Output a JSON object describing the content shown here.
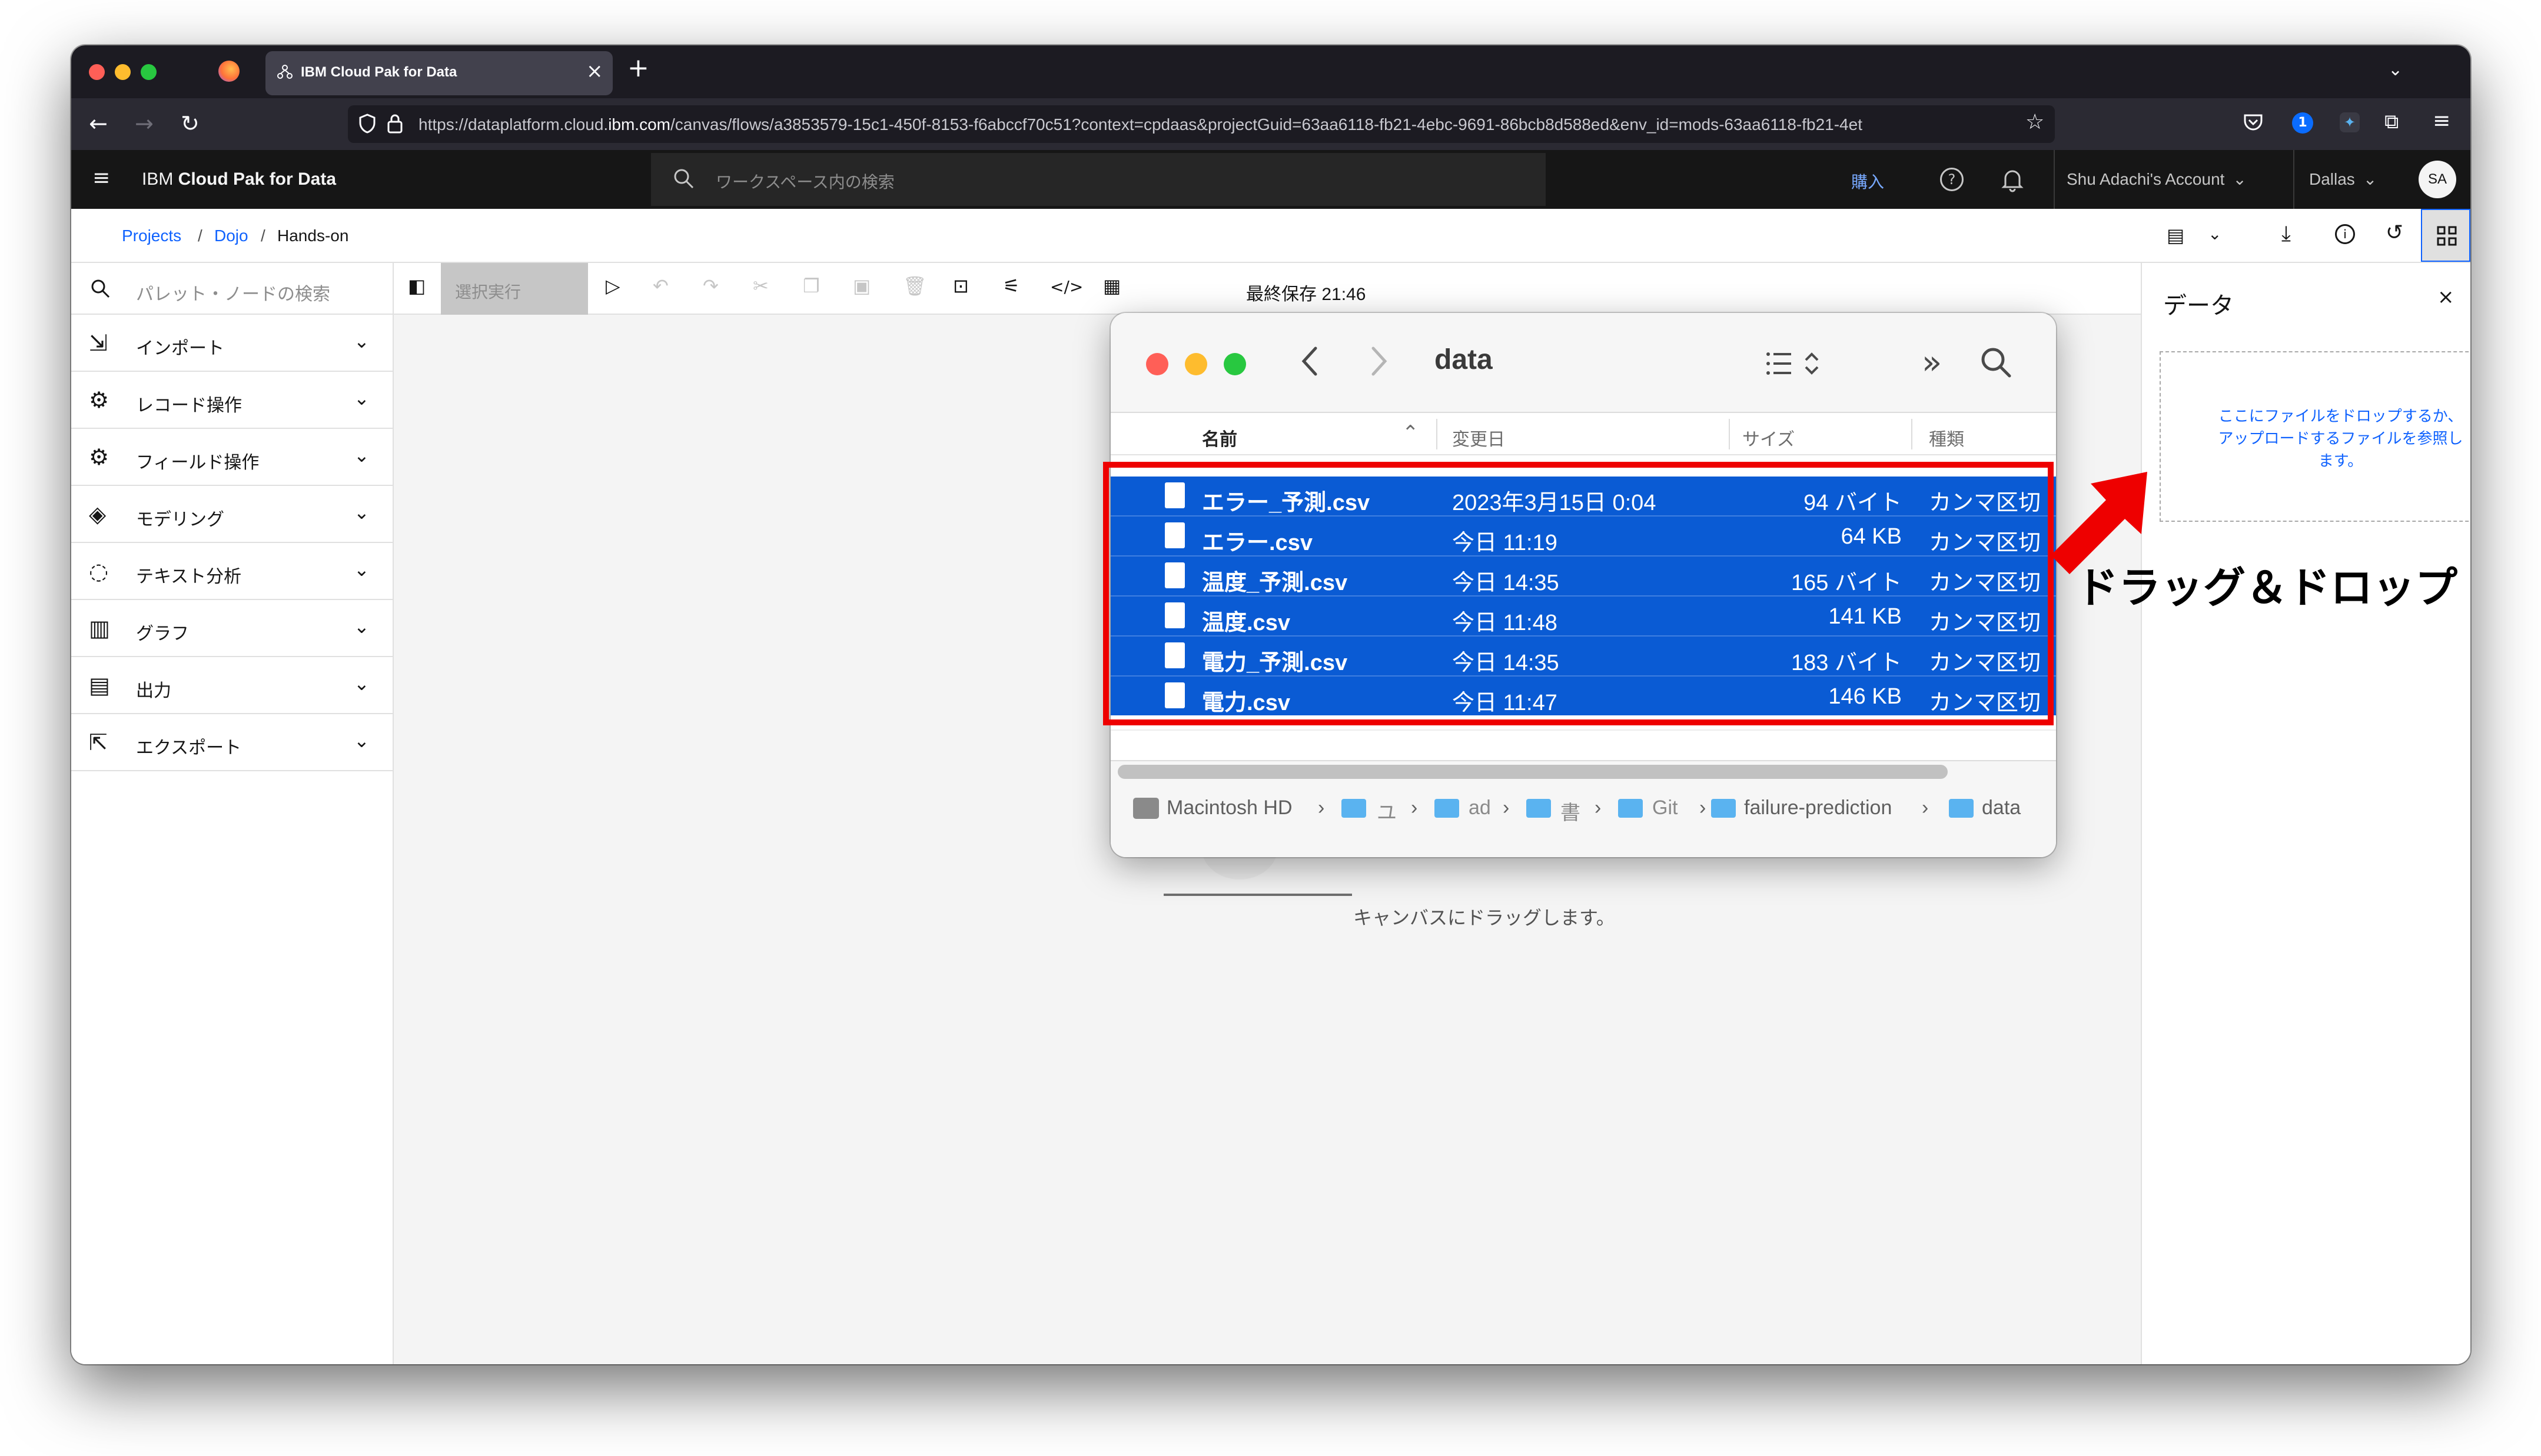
{
  "browser": {
    "tab_title": "IBM Cloud Pak for Data",
    "tab_close": "×",
    "new_tab": "+",
    "url_prefix": "https://dataplatform.cloud.",
    "url_domain": "ibm.com",
    "url_rest": "/canvas/flows/a3853579-15c1-450f-8153-f6abccf70c51?context=cpdaas&projectGuid=63aa6118-fb21-4ebc-9691-86bcb8d588ed&env_id=mods-63aa6118-fb21-4et"
  },
  "header": {
    "title_plain": "IBM ",
    "title_bold": "Cloud Pak for Data",
    "search_placeholder": "ワークスペース内の検索",
    "buy": "購入",
    "account": "Shu Adachi's Account",
    "region": "Dallas",
    "avatar": "SA"
  },
  "breadcrumb": {
    "projects": "Projects",
    "dojo": "Dojo",
    "current": "Hands-on",
    "sep": "/"
  },
  "palette": {
    "search_placeholder": "パレット・ノードの検索",
    "items": [
      {
        "label": "インポート",
        "icon": "import-icon"
      },
      {
        "label": "レコード操作",
        "icon": "record-ops-icon"
      },
      {
        "label": "フィールド操作",
        "icon": "field-ops-icon"
      },
      {
        "label": "モデリング",
        "icon": "modeling-icon"
      },
      {
        "label": "テキスト分析",
        "icon": "text-analytics-icon"
      },
      {
        "label": "グラフ",
        "icon": "graph-icon"
      },
      {
        "label": "出力",
        "icon": "output-icon"
      },
      {
        "label": "エクスポート",
        "icon": "export-icon"
      }
    ]
  },
  "toolbar": {
    "run_selection": "選択実行",
    "last_saved": "最終保存 21:46"
  },
  "canvas": {
    "hint": "キャンバスにドラッグします。"
  },
  "right_panel": {
    "title": "データ",
    "close": "×",
    "drop_line1": "ここにファイルをドロップするか、",
    "drop_line2": "アップロードするファイルを参照し",
    "drop_line3": "ます。"
  },
  "finder": {
    "folder_title": "data",
    "columns": {
      "name": "名前",
      "modified": "変更日",
      "size": "サイズ",
      "kind": "種類"
    },
    "files": [
      {
        "name": "エラー_予測.csv",
        "modified": "2023年3月15日 0:04",
        "size": "94 バイト",
        "kind": "カンマ区切"
      },
      {
        "name": "エラー.csv",
        "modified": "今日 11:19",
        "size": "64 KB",
        "kind": "カンマ区切"
      },
      {
        "name": "温度_予測.csv",
        "modified": "今日 14:35",
        "size": "165 バイト",
        "kind": "カンマ区切"
      },
      {
        "name": "温度.csv",
        "modified": "今日 11:48",
        "size": "141 KB",
        "kind": "カンマ区切"
      },
      {
        "name": "電力_予測.csv",
        "modified": "今日 14:35",
        "size": "183 バイト",
        "kind": "カンマ区切"
      },
      {
        "name": "電力.csv",
        "modified": "今日 11:47",
        "size": "146 KB",
        "kind": "カンマ区切"
      }
    ],
    "path": [
      "Macintosh HD",
      "ユ",
      "ad",
      "書",
      "Git",
      "failure-prediction",
      "data"
    ],
    "path_sep": "›"
  },
  "annotation": {
    "drag_drop": "ドラッグ＆ドロップ"
  },
  "colors": {
    "ibm_header": "#161616",
    "finder_selection": "#0a5bd4",
    "annotation_red": "#ee0000",
    "link_blue": "#0f62fe"
  }
}
